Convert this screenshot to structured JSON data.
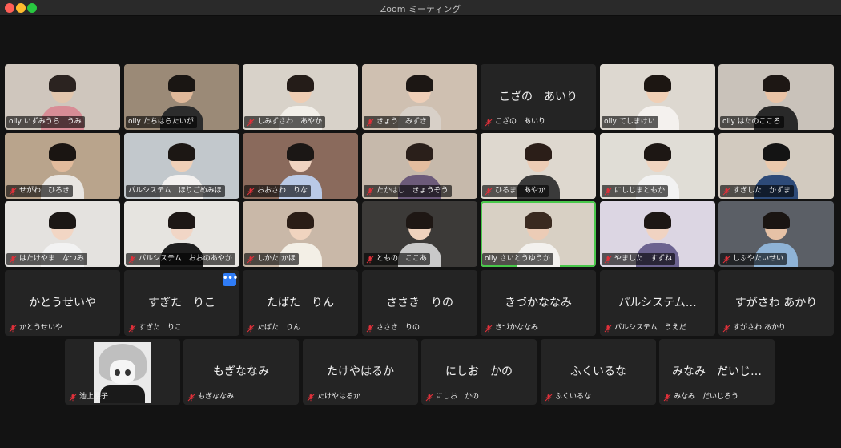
{
  "window": {
    "title": "Zoom ミーティング"
  },
  "colors": {
    "active_speaker": "#49c84b",
    "muted_icon": "#e0303a",
    "more_button": "#2f7cf6",
    "tile_bg": "#242424"
  },
  "participants": [
    {
      "label": "olly いずみうら　うみ",
      "video": true,
      "muted": false
    },
    {
      "label": "olly たちはらたいが",
      "video": true,
      "muted": false
    },
    {
      "label": "しみずさわ　あやか",
      "video": true,
      "muted": true
    },
    {
      "label": "きょう　みずき",
      "video": true,
      "muted": true
    },
    {
      "name": "こざの　あいり",
      "label": "こざの　あいり",
      "video": false,
      "muted": true
    },
    {
      "label": "olly てしまけい",
      "video": true,
      "muted": false
    },
    {
      "label": "olly はたのこころ",
      "video": true,
      "muted": false
    },
    {
      "label": "せがわ　ひろき",
      "video": true,
      "muted": true
    },
    {
      "label": "パルシステム　ほりごめみほ",
      "video": true,
      "muted": false
    },
    {
      "label": "おおさわ　りな",
      "video": true,
      "muted": true
    },
    {
      "label": "たかはし　きょうぞう",
      "video": true,
      "muted": true
    },
    {
      "label": "ひるま　あやか",
      "video": true,
      "muted": true
    },
    {
      "label": "にしじまともか",
      "video": true,
      "muted": true
    },
    {
      "label": "すぎした　かずま",
      "video": true,
      "muted": true
    },
    {
      "label": "はたけやま　なつみ",
      "video": true,
      "muted": true
    },
    {
      "label": "パルシステム　おおのあやか",
      "video": true,
      "muted": true
    },
    {
      "label": "しかた かほ",
      "video": true,
      "muted": true
    },
    {
      "label": "ともの　ここあ",
      "video": true,
      "muted": true
    },
    {
      "label": "olly さいとうゆうか",
      "video": true,
      "muted": false,
      "active": true
    },
    {
      "label": "やました　すずね",
      "video": true,
      "muted": true
    },
    {
      "label": "しぶやたいせい",
      "video": true,
      "muted": true
    },
    {
      "name": "かとうせいや",
      "label": "かとうせいや",
      "video": false,
      "muted": true
    },
    {
      "name": "すぎた　りこ",
      "label": "すぎた　りこ",
      "video": false,
      "muted": true,
      "more": "•••"
    },
    {
      "name": "たばた　りん",
      "label": "たばた　りん",
      "video": false,
      "muted": true
    },
    {
      "name": "ささき　りの",
      "label": "ささき　りの",
      "video": false,
      "muted": true
    },
    {
      "name": "きづかななみ",
      "label": "きづかななみ",
      "video": false,
      "muted": true
    },
    {
      "name": "パルシステム…",
      "label": "パルシステム　うえだ",
      "video": false,
      "muted": true
    },
    {
      "name": "すがさわ あかり",
      "label": "すがさわ あかり",
      "video": false,
      "muted": true
    },
    {
      "label": "池上櫻子",
      "video": false,
      "avatar": true,
      "muted": true
    },
    {
      "name": "もぎななみ",
      "label": "もぎななみ",
      "video": false,
      "muted": true
    },
    {
      "name": "たけやはるか",
      "label": "たけやはるか",
      "video": false,
      "muted": true
    },
    {
      "name": "にしお　かの",
      "label": "にしお　かの",
      "video": false,
      "muted": true
    },
    {
      "name": "ふくいるな",
      "label": "ふくいるな",
      "video": false,
      "muted": true
    },
    {
      "name": "みなみ　だいじ…",
      "label": "みなみ　だいじろう",
      "video": false,
      "muted": true
    }
  ]
}
